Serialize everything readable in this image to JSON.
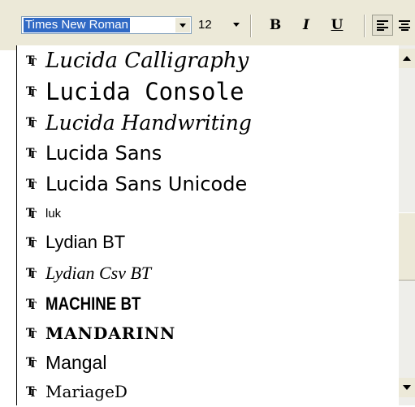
{
  "toolbar": {
    "font_name": "Times New Roman",
    "font_size": "12",
    "bold_label": "B",
    "italic_label": "I",
    "underline_label": "U"
  },
  "font_list": {
    "items": [
      {
        "label": "Lucida Calligraphy"
      },
      {
        "label": "Lucida Console"
      },
      {
        "label": "Lucida Handwriting"
      },
      {
        "label": "Lucida Sans"
      },
      {
        "label": "Lucida Sans Unicode"
      },
      {
        "label": "luk"
      },
      {
        "label": "Lydian BT"
      },
      {
        "label": "Lydian Csv BT"
      },
      {
        "label": "MACHINE BT"
      },
      {
        "label": "MANDARINN"
      },
      {
        "label": "Mangal"
      },
      {
        "label": "MariageD"
      }
    ]
  },
  "colors": {
    "selection": "#316ac5",
    "toolbar_bg": "#ece9d8"
  }
}
